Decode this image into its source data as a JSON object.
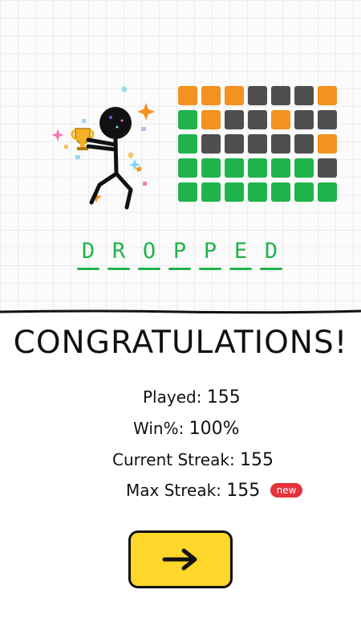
{
  "game": {
    "word": [
      "D",
      "R",
      "O",
      "P",
      "P",
      "E",
      "D"
    ],
    "guess_grid": [
      [
        "orange",
        "orange",
        "orange",
        "dark",
        "dark",
        "dark",
        "orange"
      ],
      [
        "green",
        "orange",
        "dark",
        "dark",
        "orange",
        "dark",
        "dark"
      ],
      [
        "green",
        "dark",
        "dark",
        "dark",
        "dark",
        "dark",
        "orange"
      ],
      [
        "green",
        "green",
        "green",
        "green",
        "green",
        "green",
        "dark"
      ],
      [
        "green",
        "green",
        "green",
        "green",
        "green",
        "green",
        "green"
      ]
    ],
    "colors": {
      "green": "#20b34b",
      "orange": "#f3921e",
      "dark": "#4f4f4f",
      "yellow": "#ffd62a",
      "badge": "#e5323b"
    }
  },
  "result": {
    "title": "CONGRATULATIONS!",
    "played_label": "Played:",
    "played_value": "155",
    "win_label": "Win%:",
    "win_value": "100%",
    "current_streak_label": "Current Streak:",
    "current_streak_value": "155",
    "max_streak_label": "Max Streak:",
    "max_streak_value": "155",
    "new_badge": "new"
  },
  "actions": {
    "next_icon": "arrow-right-icon"
  }
}
